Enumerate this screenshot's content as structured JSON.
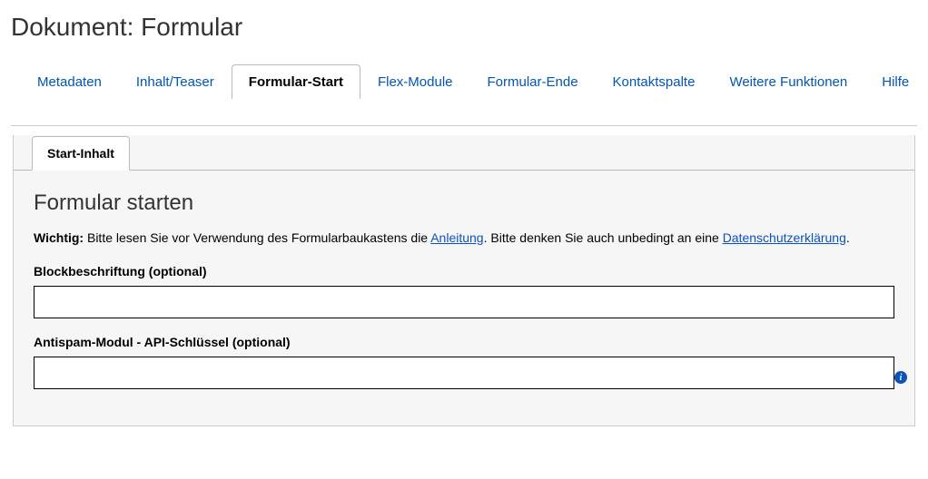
{
  "pageTitle": "Dokument: Formular",
  "mainTabs": [
    {
      "label": "Metadaten",
      "active": false
    },
    {
      "label": "Inhalt/Teaser",
      "active": false
    },
    {
      "label": "Formular-Start",
      "active": true
    },
    {
      "label": "Flex-Module",
      "active": false
    },
    {
      "label": "Formular-Ende",
      "active": false
    },
    {
      "label": "Kontaktspalte",
      "active": false
    },
    {
      "label": "Weitere Funktionen",
      "active": false
    },
    {
      "label": "Hilfe",
      "active": false
    }
  ],
  "subTab": {
    "label": "Start-Inhalt"
  },
  "section": {
    "title": "Formular starten",
    "notice": {
      "strong": "Wichtig:",
      "part1": " Bitte lesen Sie vor Verwendung des Formularbaukastens die ",
      "link1": "Anleitung",
      "part2": ". Bitte denken Sie auch unbedingt an eine ",
      "link2": "Datenschutzerklärung",
      "part3": "."
    },
    "field1": {
      "label": "Blockbeschriftung (optional)",
      "value": ""
    },
    "field2": {
      "label": "Antispam-Modul - API-Schlüssel (optional)",
      "value": ""
    }
  },
  "icons": {
    "info": "i"
  },
  "colors": {
    "link": "#0a53be",
    "panelBg": "#f6f6f6",
    "border": "#bbb"
  }
}
